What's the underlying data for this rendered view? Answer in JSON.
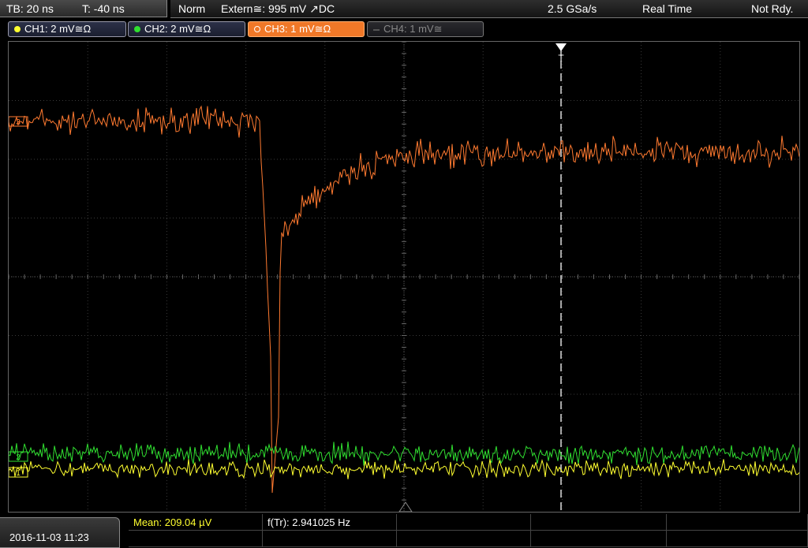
{
  "timebase": {
    "tb": "TB: 20 ns",
    "t": "T: -40 ns"
  },
  "trigger": {
    "mode": "Norm",
    "source": "Extern≅: 995 mV ↗DC",
    "sample_rate": "2.5 GSa/s",
    "acq_mode": "Real Time",
    "status": "Not Rdy."
  },
  "channels": [
    {
      "label": "CH1: 2 mV≅Ω",
      "color": "#ffff30"
    },
    {
      "label": "CH2: 2 mV≅Ω",
      "color": "#30e030"
    },
    {
      "label": "CH3: 1 mV≅Ω",
      "color": "#ff7a30"
    },
    {
      "label": "CH4: 1 mV≅",
      "color": "#777777"
    }
  ],
  "markers": {
    "trigger": "T",
    "ch_levels": [
      "1",
      "2",
      "3"
    ]
  },
  "datetime": "2016-11-03 11:23",
  "measurements": {
    "mean": "Mean: 209.04 µV",
    "freq": "f(Tr): 2.941025 Hz"
  }
}
